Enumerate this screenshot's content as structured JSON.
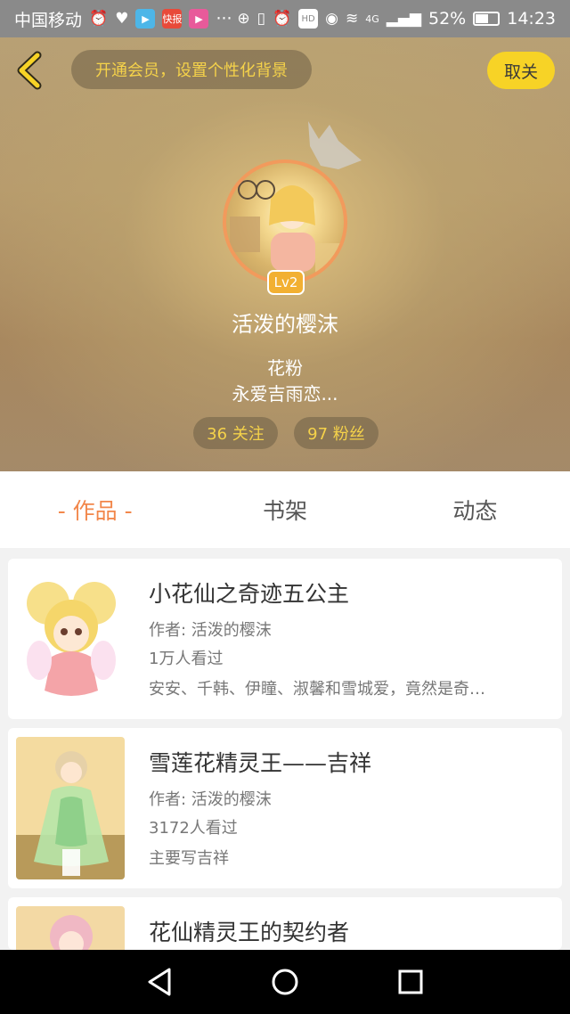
{
  "status_bar": {
    "carrier": "中国移动",
    "app_badge_text": "快报",
    "dots": "···",
    "hd_label": "HD",
    "network": "4G",
    "battery": "52%",
    "time": "14:23"
  },
  "header": {
    "member_promo": "开通会员，设置个性化背景",
    "unfollow_label": "取关",
    "level": "Lv2",
    "username": "活泼的樱沫",
    "role": "花粉",
    "bio": "永爱吉雨恋...",
    "following": "36 关注",
    "fans": "97 粉丝"
  },
  "tabs": [
    {
      "label": "- 作品 -",
      "active": true
    },
    {
      "label": "书架",
      "active": false
    },
    {
      "label": "动态",
      "active": false
    }
  ],
  "works": [
    {
      "title": "小花仙之奇迹五公主",
      "author": "作者: 活泼的樱沫",
      "views": "1万人看过",
      "desc": "安安、千韩、伊瞳、淑馨和雪城爱，竟然是奇…"
    },
    {
      "title": "雪莲花精灵王——吉祥",
      "author": "作者: 活泼的樱沫",
      "views": "3172人看过",
      "desc": "主要写吉祥"
    },
    {
      "title": "花仙精灵王的契约者",
      "author": "",
      "views": "",
      "desc": ""
    }
  ],
  "colors": {
    "accent_orange": "#f2874b",
    "accent_yellow": "#f7d326",
    "pill_text": "#f5d24a"
  }
}
